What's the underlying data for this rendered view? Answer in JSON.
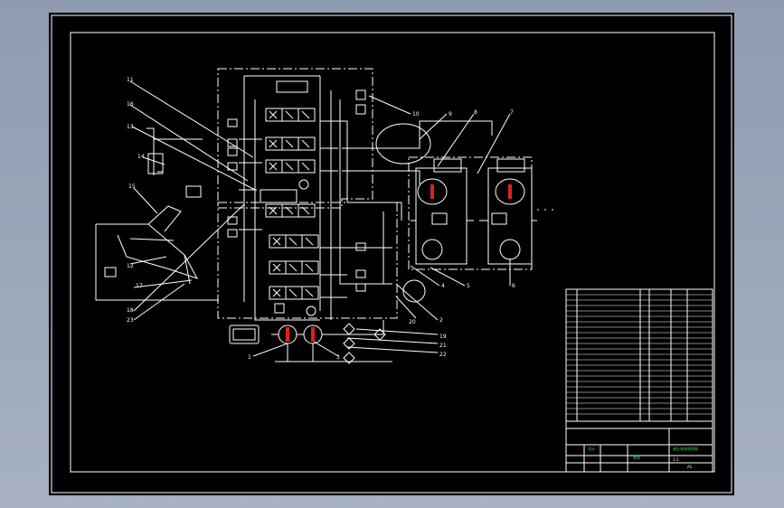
{
  "labels": {
    "n1": "1",
    "n2": "2",
    "n3": "3",
    "n4": "4",
    "n5": "5",
    "n6": "6",
    "n7": "7",
    "n8": "8",
    "n9": "9",
    "n10": "10",
    "n11": "11",
    "n12": "12",
    "n13": "13",
    "n14": "14",
    "n15": "15",
    "n16": "16",
    "n17": "17",
    "n18": "18",
    "n19": "19",
    "n20": "20",
    "n21": "21",
    "n22": "22",
    "n23": "23"
  },
  "colors": {
    "line": "#ffffff",
    "pump_marker": "#e02020",
    "title_green": "#27e04a",
    "viewport_bg": "#000000",
    "app_bg": "#9aa5b8"
  },
  "titleblock": {
    "scale": "1:1",
    "sheet": "A1",
    "green_1": "液压系统原理图",
    "green_2": "设计",
    "green_3": "审核"
  }
}
